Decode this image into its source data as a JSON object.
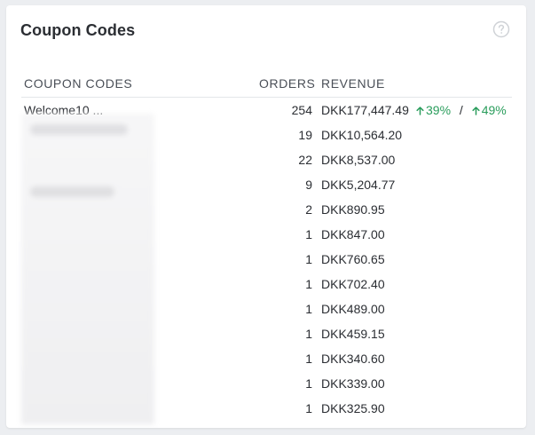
{
  "card": {
    "title": "Coupon Codes",
    "help_icon": "question-circle-icon"
  },
  "table": {
    "headers": {
      "code": "COUPON CODES",
      "orders": "ORDERS",
      "revenue": "REVENUE"
    },
    "rows": [
      {
        "code": "Welcome10 ...",
        "orders": "254",
        "revenue": "DKK177,447.49"
      },
      {
        "code": "",
        "orders": "19",
        "revenue": "DKK10,564.20"
      },
      {
        "code": "",
        "orders": "22",
        "revenue": "DKK8,537.00"
      },
      {
        "code": "",
        "orders": "9",
        "revenue": "DKK5,204.77"
      },
      {
        "code": "",
        "orders": "2",
        "revenue": "DKK890.95"
      },
      {
        "code": "",
        "orders": "1",
        "revenue": "DKK847.00"
      },
      {
        "code": "",
        "orders": "1",
        "revenue": "DKK760.65"
      },
      {
        "code": "",
        "orders": "1",
        "revenue": "DKK702.40"
      },
      {
        "code": "",
        "orders": "1",
        "revenue": "DKK489.00"
      },
      {
        "code": "",
        "orders": "1",
        "revenue": "DKK459.15"
      },
      {
        "code": "",
        "orders": "1",
        "revenue": "DKK340.60"
      },
      {
        "code": "",
        "orders": "1",
        "revenue": "DKK339.00"
      },
      {
        "code": "",
        "orders": "1",
        "revenue": "DKK325.90"
      }
    ],
    "first_row_changes": {
      "orders_change": "39%",
      "revenue_change": "49%",
      "separator": "/"
    }
  },
  "colors": {
    "positive": "#2a9d5c",
    "card_background": "#ffffff",
    "page_background": "#eceef1"
  }
}
